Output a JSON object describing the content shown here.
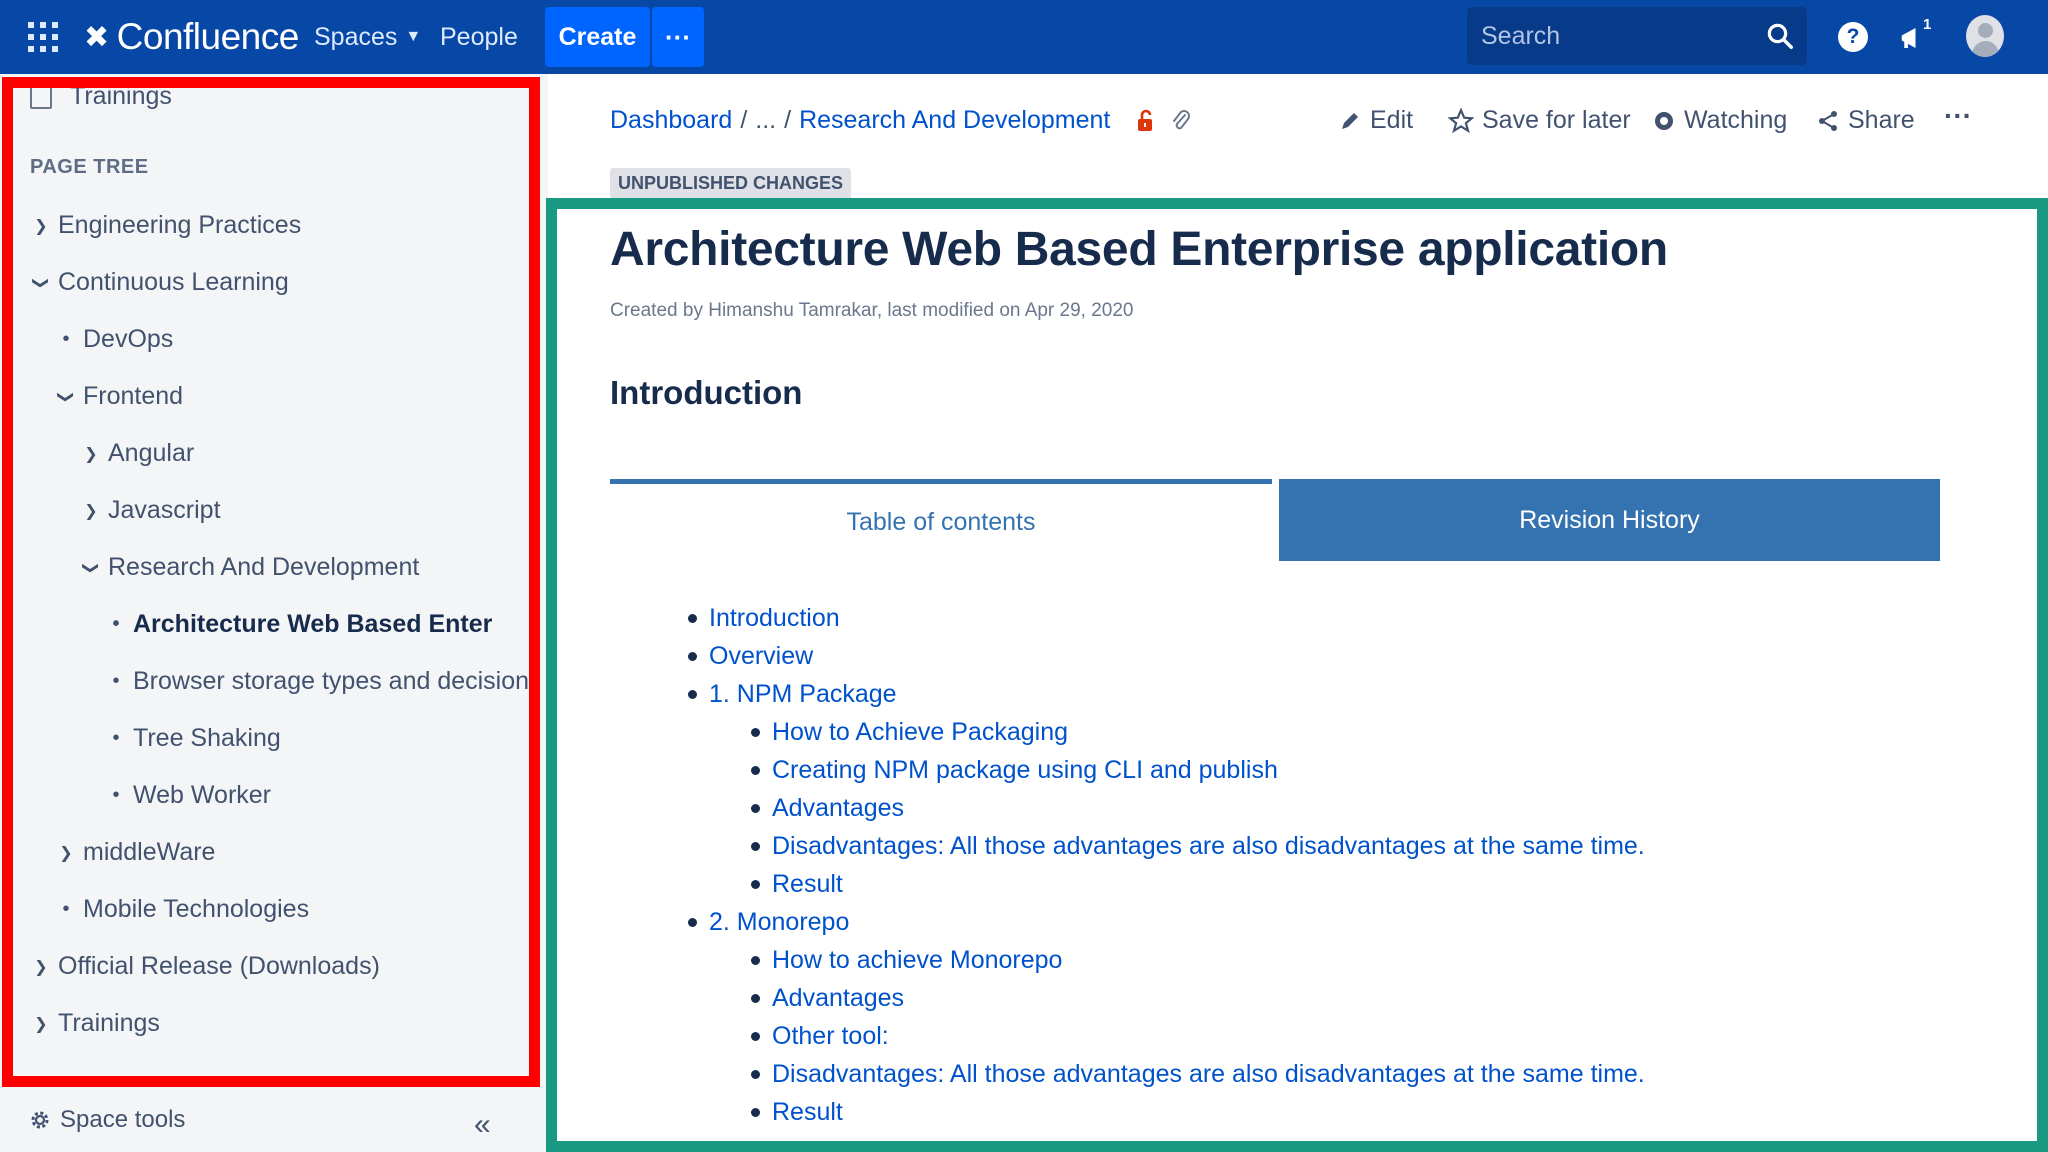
{
  "topnav": {
    "app_name": "Confluence",
    "spaces_label": "Spaces",
    "people_label": "People",
    "create_label": "Create",
    "more_label": "···",
    "search_placeholder": "Search",
    "help_label": "?",
    "notification_count": "1",
    "colors": {
      "nav_bg": "#0747a6",
      "create_bg": "#0065ff"
    }
  },
  "sidebar": {
    "top_item": "Trainings",
    "page_tree_heading": "PAGE TREE",
    "items": [
      {
        "label": "Engineering Practices",
        "type": "collapsed"
      },
      {
        "label": "Continuous Learning",
        "type": "expanded"
      },
      {
        "label": "DevOps",
        "type": "leaf"
      },
      {
        "label": "Frontend",
        "type": "expanded"
      },
      {
        "label": "Angular",
        "type": "collapsed"
      },
      {
        "label": "Javascript",
        "type": "collapsed"
      },
      {
        "label": "Research And Development",
        "type": "expanded"
      },
      {
        "label": "Architecture Web Based Enterprise",
        "type": "current"
      },
      {
        "label": "Browser storage types and decision",
        "type": "leaf"
      },
      {
        "label": "Tree Shaking",
        "type": "leaf"
      },
      {
        "label": "Web Worker",
        "type": "leaf"
      },
      {
        "label": "middleWare",
        "type": "collapsed"
      },
      {
        "label": "Mobile Technologies",
        "type": "leaf"
      },
      {
        "label": "Official Release (Downloads)",
        "type": "collapsed"
      },
      {
        "label": "Trainings",
        "type": "collapsed"
      }
    ],
    "space_tools_label": "Space tools",
    "collapse_label": "«",
    "highlight_color": "#ff0000"
  },
  "header": {
    "breadcrumb": [
      "Dashboard",
      "/",
      "...",
      "/",
      "Research And Development"
    ],
    "actions": {
      "edit": "Edit",
      "save_for_later": "Save for later",
      "watching": "Watching",
      "share": "Share",
      "more": "···"
    },
    "badge": "UNPUBLISHED CHANGES"
  },
  "content": {
    "title": "Architecture Web Based Enterprise application",
    "byline": "Created by Himanshu Tamrakar, last modified on Apr 29, 2020",
    "intro_heading": "Introduction",
    "tabs": [
      "Table of contents",
      "Revision History"
    ],
    "highlight_color": "#1a9982",
    "toc": [
      {
        "label": "Introduction",
        "level": 1
      },
      {
        "label": "Overview",
        "level": 1
      },
      {
        "label": "1. NPM Package",
        "level": 1
      },
      {
        "label": "How to Achieve Packaging",
        "level": 2
      },
      {
        "label": "Creating NPM package using CLI and publish",
        "level": 2
      },
      {
        "label": "Advantages",
        "level": 2
      },
      {
        "label": "Disadvantages: All those advantages are also disadvantages at the same time.",
        "level": 2
      },
      {
        "label": "Result",
        "level": 2
      },
      {
        "label": "2. Monorepo",
        "level": 1
      },
      {
        "label": "How to achieve Monorepo",
        "level": 2
      },
      {
        "label": "Advantages",
        "level": 2
      },
      {
        "label": "Other  tool:",
        "level": 2
      },
      {
        "label": "Disadvantages: All those advantages are also disadvantages at the same time.",
        "level": 2
      },
      {
        "label": "Result",
        "level": 2
      }
    ]
  }
}
